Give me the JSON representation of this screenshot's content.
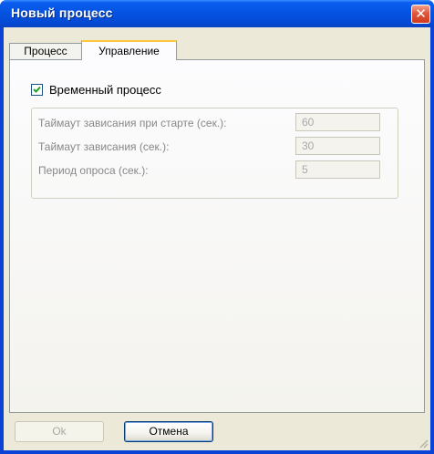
{
  "window": {
    "title": "Новый процесс",
    "close_glyph": "✕"
  },
  "tabs": [
    {
      "label": "Процесс",
      "active": false
    },
    {
      "label": "Управление",
      "active": true
    }
  ],
  "control": {
    "temporary_process": {
      "label": "Временный процесс",
      "checked": true
    },
    "fields": [
      {
        "label": "Таймаут зависания при старте (сек.):",
        "value": "60"
      },
      {
        "label": "Таймаут зависания (сек.):",
        "value": "30"
      },
      {
        "label": "Период опроса (сек.):",
        "value": "5"
      }
    ]
  },
  "buttons": {
    "ok_label": "Ok",
    "cancel_label": "Отмена"
  },
  "colors": {
    "titlebar": "#0552e0",
    "close": "#e2573b",
    "tab_highlight": "#ffc83c",
    "dialog_bg": "#ece9d8"
  }
}
